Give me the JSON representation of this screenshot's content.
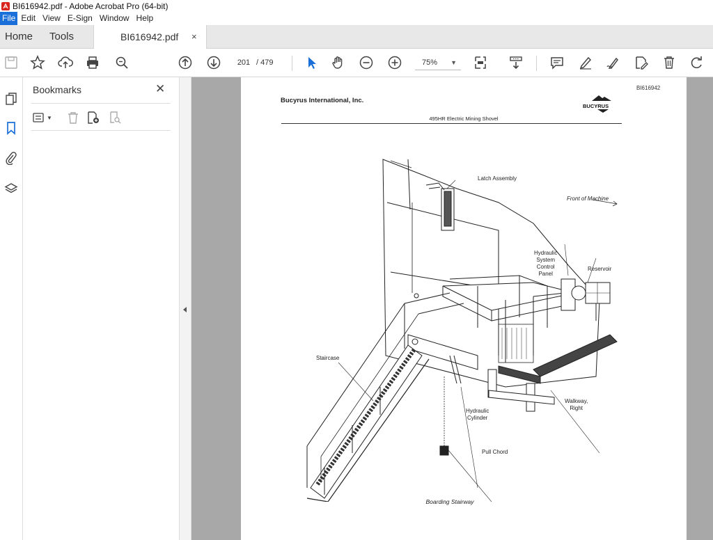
{
  "window": {
    "title": "BI616942.pdf - Adobe Acrobat Pro (64-bit)"
  },
  "menu": [
    "File",
    "Edit",
    "View",
    "E-Sign",
    "Window",
    "Help"
  ],
  "tabs": {
    "home": "Home",
    "tools": "Tools",
    "doc": "BI616942.pdf",
    "close": "×"
  },
  "toolbar": {
    "page_current": "201",
    "page_total": "/ 479",
    "zoom": "75%"
  },
  "bookmarks": {
    "title": "Bookmarks",
    "close": "✕"
  },
  "document": {
    "page_id": "BI616942",
    "company": "Bucyrus International, Inc.",
    "brand": "BUCYRUS",
    "subtitle": "495HR Electric Mining Shovel",
    "labels": {
      "latch": "Latch Assembly",
      "front": "Front of Machine",
      "hydraulic_panel": "Hydraulic\nSystem\nControl\nPanel",
      "reservoir": "Reservoir",
      "staircase": "Staircase",
      "walkway": "Walkway,\nRight",
      "cylinder": "Hydraulic\nCylinder",
      "pull": "Pull Chord"
    },
    "caption": "Boarding Stairway"
  },
  "colors": {
    "accent": "#1a6fd8",
    "doc_bg": "#a8a8a8"
  }
}
